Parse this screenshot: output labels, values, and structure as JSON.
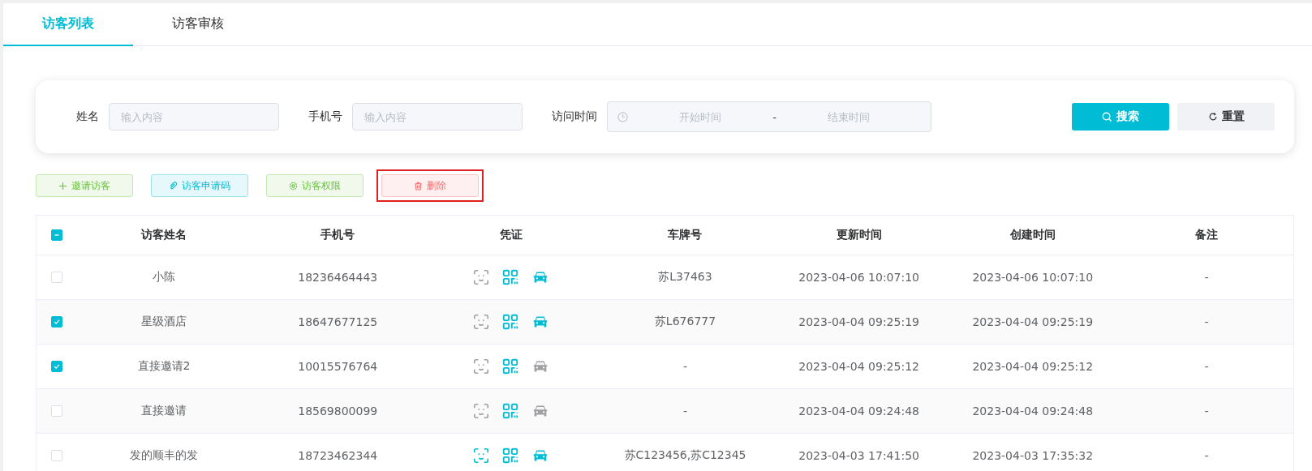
{
  "tabs": [
    {
      "label": "访客列表",
      "selected": true
    },
    {
      "label": "访客审核",
      "selected": false
    }
  ],
  "filters": {
    "fields": [
      {
        "label": "姓名",
        "placeholder": "输入内容"
      },
      {
        "label": "手机号",
        "placeholder": "输入内容"
      }
    ],
    "date_range": {
      "label": "访问时间",
      "start_placeholder": "开始时间",
      "separator": "-",
      "end_placeholder": "结束时间"
    },
    "search_button": "搜索",
    "reset_button": "重置"
  },
  "actions": [
    {
      "kind": "invite",
      "label": "邀请访客",
      "highlighted": false
    },
    {
      "kind": "code",
      "label": "访客申请码",
      "highlighted": false
    },
    {
      "kind": "permission",
      "label": "访客权限",
      "highlighted": false
    },
    {
      "kind": "delete",
      "label": "删除",
      "highlighted": true
    }
  ],
  "table": {
    "select_all_partial": true,
    "columns": [
      "访客姓名",
      "手机号",
      "凭证",
      "车牌号",
      "更新时间",
      "创建时间",
      "备注"
    ],
    "rows": [
      {
        "checked": false,
        "name": "小陈",
        "phone": "18236464443",
        "face": false,
        "qrcode": true,
        "vehicle": true,
        "plate": "苏L37463",
        "updated": "2023-04-06 10:07:10",
        "created": "2023-04-06 10:07:10",
        "note": "-"
      },
      {
        "checked": true,
        "name": "星级酒店",
        "phone": "18647677125",
        "face": false,
        "qrcode": true,
        "vehicle": true,
        "plate": "苏L676777",
        "updated": "2023-04-04 09:25:19",
        "created": "2023-04-04 09:25:19",
        "note": "-"
      },
      {
        "checked": true,
        "name": "直接邀请2",
        "phone": "10015576764",
        "face": false,
        "qrcode": true,
        "vehicle": false,
        "plate": "-",
        "updated": "2023-04-04 09:25:12",
        "created": "2023-04-04 09:25:12",
        "note": "-"
      },
      {
        "checked": false,
        "name": "直接邀请",
        "phone": "18569800099",
        "face": false,
        "qrcode": true,
        "vehicle": false,
        "plate": "-",
        "updated": "2023-04-04 09:24:48",
        "created": "2023-04-04 09:24:48",
        "note": "-"
      },
      {
        "checked": false,
        "name": "发的顺丰的发",
        "phone": "18723462344",
        "face": true,
        "qrcode": true,
        "vehicle": true,
        "plate": "苏C123456,苏C12345",
        "updated": "2023-04-03 17:41:50",
        "created": "2023-04-03 17:35:32",
        "note": "-"
      }
    ]
  }
}
